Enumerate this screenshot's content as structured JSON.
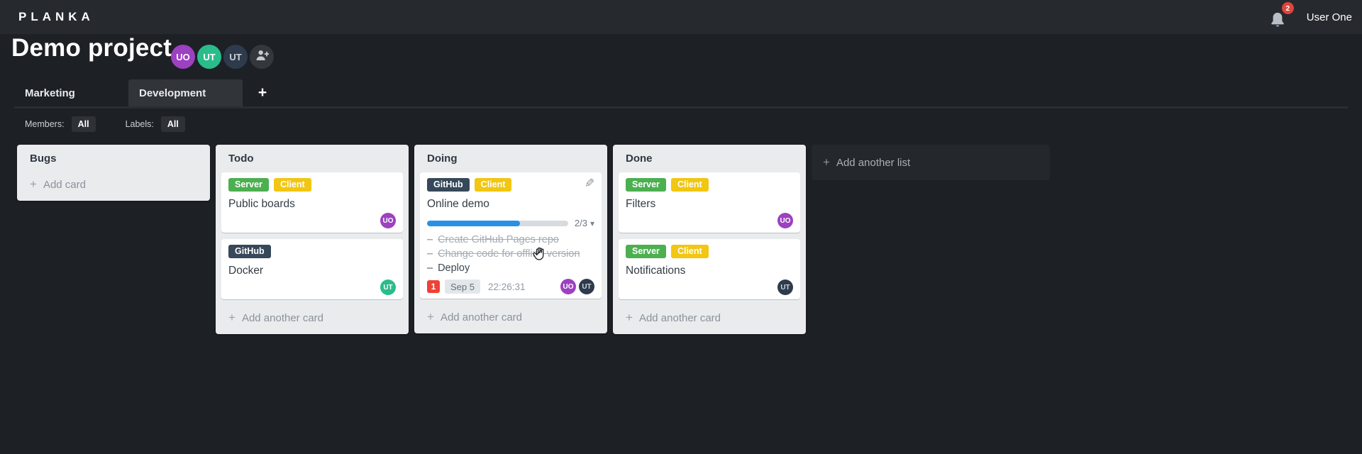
{
  "topbar": {
    "logo": "PLANKA",
    "notification_count": "2",
    "user_name": "User One"
  },
  "project": {
    "title": "Demo project",
    "members": [
      {
        "initials": "UO",
        "color": "#9c41c0"
      },
      {
        "initials": "UT",
        "color": "#2abd8c"
      },
      {
        "initials": "UT",
        "color": "#2e3b4c"
      }
    ]
  },
  "tabs": [
    {
      "label": "Marketing"
    },
    {
      "label": "Development"
    }
  ],
  "filters": {
    "members_label": "Members:",
    "members_value": "All",
    "labels_label": "Labels:",
    "labels_value": "All"
  },
  "board": {
    "add_list_label": "Add another list",
    "lists": [
      {
        "name": "Bugs",
        "add_label": "Add card",
        "cards": []
      },
      {
        "name": "Todo",
        "add_label": "Add another card",
        "cards": [
          {
            "title": "Public boards",
            "labels": [
              {
                "text": "Server",
                "color": "#4caf50"
              },
              {
                "text": "Client",
                "color": "#f2c611"
              }
            ],
            "members": [
              {
                "initials": "UO",
                "color": "#9c41c0"
              }
            ]
          },
          {
            "title": "Docker",
            "labels": [
              {
                "text": "GitHub",
                "color": "#36485a"
              }
            ],
            "members": [
              {
                "initials": "UT",
                "color": "#2abd8c"
              }
            ]
          }
        ]
      },
      {
        "name": "Doing",
        "add_label": "Add another card",
        "cards": [
          {
            "title": "Online demo",
            "labels": [
              {
                "text": "GitHub",
                "color": "#36485a"
              },
              {
                "text": "Client",
                "color": "#f2c611"
              }
            ],
            "progress": {
              "label": "2/3",
              "percent": 66
            },
            "tasks": [
              {
                "text": "Create GitHub Pages repo"
              },
              {
                "text": "Change code for offline version"
              },
              {
                "text": "Deploy"
              }
            ],
            "badges": {
              "notifications": "1",
              "due_date": "Sep 5",
              "timer": "22:26:31"
            },
            "members": [
              {
                "initials": "UO",
                "color": "#9c41c0"
              },
              {
                "initials": "UT",
                "color": "#2e3b4c"
              }
            ]
          }
        ]
      },
      {
        "name": "Done",
        "add_label": "Add another card",
        "cards": [
          {
            "title": "Filters",
            "labels": [
              {
                "text": "Server",
                "color": "#4caf50"
              },
              {
                "text": "Client",
                "color": "#f2c611"
              }
            ],
            "members": [
              {
                "initials": "UO",
                "color": "#9c41c0"
              }
            ]
          },
          {
            "title": "Notifications",
            "labels": [
              {
                "text": "Server",
                "color": "#4caf50"
              },
              {
                "text": "Client",
                "color": "#f2c611"
              }
            ],
            "members": [
              {
                "initials": "UT",
                "color": "#2e3b4c"
              }
            ]
          }
        ]
      }
    ]
  },
  "icons": {
    "plus": "+",
    "pencil": "✎",
    "chevron_down": "▾",
    "dash": "–"
  }
}
